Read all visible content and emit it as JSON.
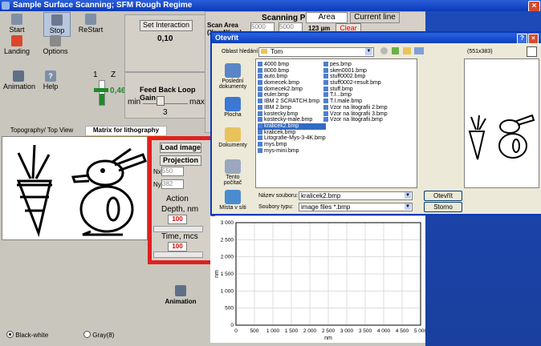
{
  "app": {
    "title": "Sample Surface Scanning; SFM Rough Regime"
  },
  "toolbar": {
    "start": "Start",
    "stop": "Stop",
    "restart": "ReStart",
    "landing": "Landing",
    "options": "Options",
    "animation": "Animation",
    "help": "Help"
  },
  "interaction": {
    "button": "Set Interaction",
    "value": "0,10"
  },
  "z_slider": {
    "label_1": "1",
    "label_z": "Z",
    "value": "0,46"
  },
  "feedback": {
    "title": "Feed Back Loop Gain",
    "min": "min",
    "max": "max",
    "value": "3",
    "level": 0.35
  },
  "scan": {
    "header": "Scanning Parameters",
    "area_label": "Scan Area (Xnm*Ynm)",
    "x": "5000",
    "y": "5000",
    "tab_area": "Area",
    "tab_current": "Current line",
    "size": "123 µm",
    "clear": "Clear"
  },
  "tabs": {
    "topo": "Topography/ Top View",
    "matrix": "Matrix for lithography"
  },
  "litho": {
    "load_image": "Load image",
    "projection": "Projection",
    "nx_label": "Nx",
    "nx_value": "550",
    "ny_label": "Ny",
    "ny_value": "382",
    "action": "Action",
    "depth_label": "Depth, nm",
    "depth_value": "100",
    "time_label": "Time, mcs",
    "time_value": "100"
  },
  "animation_label": "Animation",
  "colormode": {
    "bw": "Black-white",
    "gray": "Gray(8)"
  },
  "chart_data": {
    "type": "line",
    "xlabel": "nm",
    "ylabel": "nm",
    "xlim": [
      0,
      5000
    ],
    "ylim": [
      0,
      3000
    ],
    "xticks": [
      "0",
      "500",
      "1 000",
      "1 500",
      "2 000",
      "2 500",
      "3 000",
      "3 500",
      "4 000",
      "4 500",
      "5 000"
    ],
    "yticks": [
      "0",
      "500",
      "1 000",
      "1 500",
      "2 000",
      "2 500",
      "3 000"
    ],
    "grid": true,
    "series": []
  },
  "dialog": {
    "title": "Otevřít",
    "look_in_label": "Oblast hledání:",
    "look_in_value": "Tom",
    "preview_size": "(551x383)",
    "places": [
      "Poslední dokumenty",
      "Plocha",
      "Dokumenty",
      "Tento počítač",
      "Místa v síti"
    ],
    "files_col1": [
      "4000.bmp",
      "8000.bmp",
      "auto.bmp",
      "domecek.bmp",
      "domecek2.bmp",
      "euler.bmp",
      "IBM 2 SCRATCH.bmp",
      "IBM 2.bmp",
      "kostecky.bmp",
      "kostecky-male.bmp",
      "kralicek2.bmp",
      "kralicek.bmp",
      "Litografie-Mys-3-4K.bmp",
      "mys.bmp",
      "mys-mini.bmp"
    ],
    "files_col2": [
      "pes.bmp",
      "sken0001.bmp",
      "stuff0002.bmp",
      "stuff0002-result.bmp",
      "stuff.bmp",
      "T.I...bmp",
      "T.I.male.bmp",
      "Vzor na litografii 2.bmp",
      "Vzor na litografii 3.bmp",
      "Vzor na litografii.bmp"
    ],
    "selected_file": "kralicek2.bmp",
    "filename_label": "Název souboru:",
    "filename_value": "kralicek2.bmp",
    "filetype_label": "Soubory typu:",
    "filetype_value": "image  files *.bmp",
    "open": "Otevřít",
    "cancel": "Storno"
  }
}
